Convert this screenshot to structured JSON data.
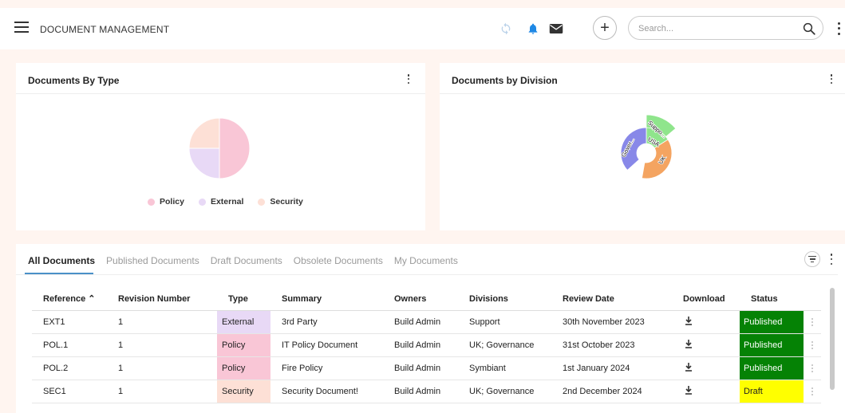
{
  "header": {
    "title": "DOCUMENT MANAGEMENT",
    "search_placeholder": "Search...",
    "plus_label": "+"
  },
  "icons": {
    "menu": "hamburger-icon",
    "sync": "sync-icon",
    "notifications": "bell-icon",
    "mail": "mail-icon",
    "search": "search-icon",
    "more": "more-vertical-icon",
    "filter": "filter-icon",
    "download": "download-icon"
  },
  "colors": {
    "policy": "#f9c6d6",
    "external": "#e8d9f6",
    "security": "#fde0d6",
    "published": "#058205",
    "draft": "#ffff00",
    "tab_accent": "#4a90c8",
    "division_support": "#8fe58c",
    "division_usa": "#8fe58c",
    "division_uk": "#f4a461",
    "division_governance": "#8888e8"
  },
  "cards": {
    "type_title": "Documents By Type",
    "division_title": "Documents by Division"
  },
  "pie_by_type": {
    "legend": [
      {
        "label": "Policy",
        "color": "#f9c6d6"
      },
      {
        "label": "External",
        "color": "#e8d9f6"
      },
      {
        "label": "Security",
        "color": "#fde0d6"
      }
    ]
  },
  "chart_data": [
    {
      "type": "pie",
      "title": "Documents By Type",
      "categories": [
        "Policy",
        "External",
        "Security"
      ],
      "values": [
        2,
        1,
        1
      ],
      "legend_position": "bottom"
    },
    {
      "type": "pie",
      "subtype": "sunburst",
      "title": "Documents by Division",
      "rings": [
        {
          "level": "inner",
          "categories": [
            "USA",
            "UK",
            "Governance"
          ],
          "values": [
            1,
            2,
            2
          ]
        },
        {
          "level": "outer",
          "categories": [
            "Suppo..."
          ],
          "values": [
            1
          ]
        }
      ],
      "labels": [
        "Suppo...",
        "USA",
        "UK",
        "Gover..."
      ]
    }
  ],
  "tabs": [
    {
      "label": "All Documents",
      "active": true
    },
    {
      "label": "Published Documents",
      "active": false
    },
    {
      "label": "Draft Documents",
      "active": false
    },
    {
      "label": "Obsolete Documents",
      "active": false
    },
    {
      "label": "My Documents",
      "active": false
    }
  ],
  "table": {
    "columns": [
      "Reference ⌃",
      "Revision Number",
      "Type",
      "Summary",
      "Owners",
      "Divisions",
      "Review Date",
      "Download",
      "Status"
    ],
    "rows": [
      {
        "reference": "EXT1",
        "revision": "1",
        "type": "External",
        "summary": "3rd Party",
        "owners": "Build Admin",
        "divisions": "Support",
        "review_date": "30th November 2023",
        "status": "Published"
      },
      {
        "reference": "POL.1",
        "revision": "1",
        "type": "Policy",
        "summary": "IT Policy Document",
        "owners": "Build Admin",
        "divisions": "UK; Governance",
        "review_date": "31st October 2023",
        "status": "Published"
      },
      {
        "reference": "POL.2",
        "revision": "1",
        "type": "Policy",
        "summary": "Fire Policy",
        "owners": "Build Admin",
        "divisions": "Symbiant",
        "review_date": "1st January 2024",
        "status": "Published"
      },
      {
        "reference": "SEC1",
        "revision": "1",
        "type": "Security",
        "summary": "Security Document!",
        "owners": "Build Admin",
        "divisions": "UK; Governance",
        "review_date": "2nd December 2024",
        "status": "Draft"
      }
    ]
  }
}
